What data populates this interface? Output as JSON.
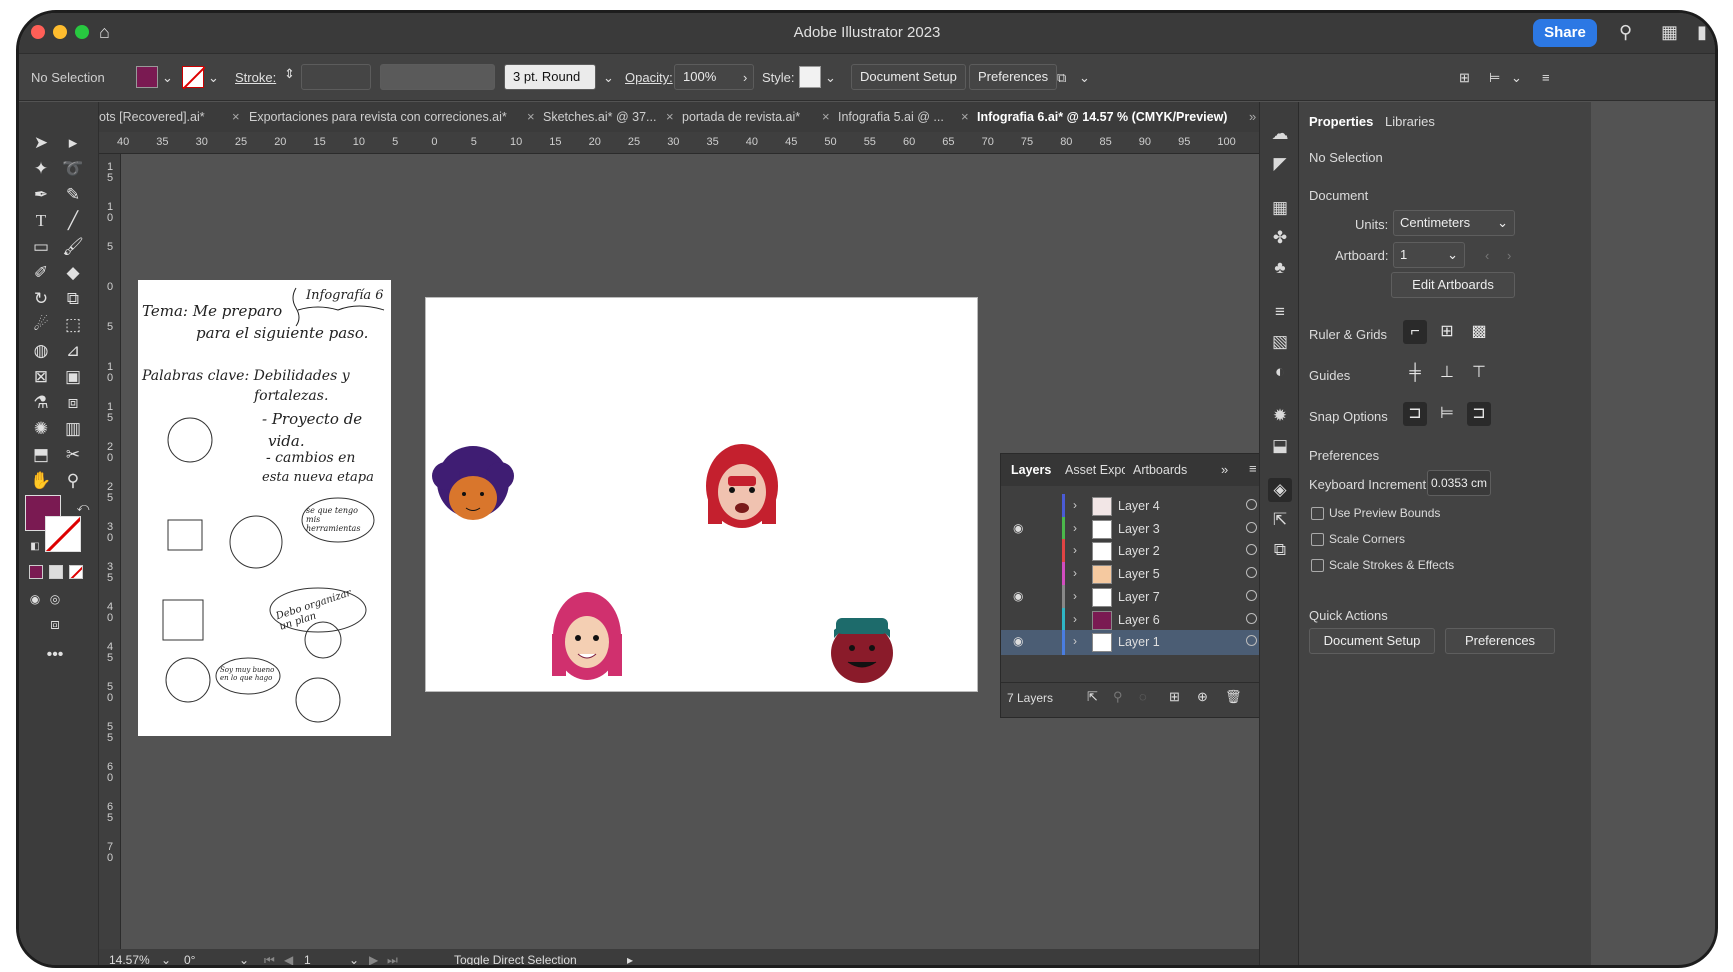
{
  "app": {
    "title": "Adobe Illustrator 2023",
    "share_label": "Share"
  },
  "control_bar": {
    "selection": "No Selection",
    "stroke_label": "Stroke:",
    "brush": "3 pt. Round",
    "opacity_label": "Opacity:",
    "opacity_value": "100%",
    "style_label": "Style:",
    "document_setup": "Document Setup",
    "preferences": "Preferences",
    "fill_color": "#7a1a52",
    "stroke_color": "#7a1a52"
  },
  "tabs": [
    {
      "label": "ots [Recovered].ai*"
    },
    {
      "label": "Exportaciones para revista con correciones.ai*"
    },
    {
      "label": "Sketches.ai* @ 37..."
    },
    {
      "label": "portada de revista.ai*"
    },
    {
      "label": "Infografia 5.ai @ ..."
    },
    {
      "label": "Infografia 6.ai* @ 14.57 % (CMYK/Preview)"
    }
  ],
  "ruler_h": [
    "40",
    "35",
    "30",
    "25",
    "20",
    "15",
    "10",
    "5",
    "0",
    "5",
    "10",
    "15",
    "20",
    "25",
    "30",
    "35",
    "40",
    "45",
    "50",
    "55",
    "60",
    "65",
    "70",
    "75",
    "80",
    "85",
    "90",
    "95",
    "100"
  ],
  "ruler_v": [
    "1 5",
    "1 0",
    "5",
    "0",
    "5",
    "1 0",
    "1 5",
    "2 0",
    "2 5",
    "3 0",
    "3 5",
    "4 0",
    "4 5",
    "5 0",
    "5 5",
    "6 0",
    "6 5",
    "7 0"
  ],
  "sketch": {
    "title": "Infografía 6",
    "line1": "Tema: Me preparo",
    "line2": "para el siguiente paso.",
    "line3": "Palabras clave: Debilidades y",
    "line4": "fortalezas.",
    "bullet1": "- Proyecto de",
    "bullet1b": "vida.",
    "bullet2": "- cambios en",
    "bullet2b": "esta nueva etapa",
    "bubble1": "Debo organizar un plan",
    "bubble2": "Soy muy bueno en lo que hago",
    "bubble3": "se que tengo mis herramientas"
  },
  "layers_panel": {
    "tabs": [
      "Layers",
      "Asset Expo",
      "Artboards"
    ],
    "count": "7 Layers",
    "rows": [
      {
        "name": "Layer 4",
        "color": "#4a5bd6",
        "visible": false,
        "thumb": "#f2e6e6"
      },
      {
        "name": "Layer 3",
        "color": "#4bb84b",
        "visible": true,
        "thumb": "#ffffff"
      },
      {
        "name": "Layer 2",
        "color": "#e04444",
        "visible": false,
        "thumb": "#ffffff"
      },
      {
        "name": "Layer 5",
        "color": "#d24dc0",
        "visible": false,
        "thumb": "#f5c9a0"
      },
      {
        "name": "Layer 7",
        "color": "#888888",
        "visible": true,
        "thumb": "#ffffff"
      },
      {
        "name": "Layer 6",
        "color": "#2fb6c5",
        "visible": false,
        "thumb": "#7a1a52"
      },
      {
        "name": "Layer 1",
        "color": "#4a7de0",
        "visible": true,
        "thumb": "#ffffff",
        "selected": true
      }
    ]
  },
  "properties": {
    "tab_properties": "Properties",
    "tab_libraries": "Libraries",
    "no_selection": "No Selection",
    "document": "Document",
    "units_label": "Units:",
    "units_value": "Centimeters",
    "artboard_label": "Artboard:",
    "artboard_value": "1",
    "edit_artboards": "Edit Artboards",
    "ruler_grids": "Ruler & Grids",
    "guides": "Guides",
    "snap_options": "Snap Options",
    "preferences": "Preferences",
    "keyboard_increment_label": "Keyboard Increment:",
    "keyboard_increment_value": "0.0353 cm",
    "use_preview_bounds": "Use Preview Bounds",
    "scale_corners": "Scale Corners",
    "scale_strokes": "Scale Strokes & Effects",
    "quick_actions": "Quick Actions",
    "qa_document_setup": "Document Setup",
    "qa_preferences": "Preferences"
  },
  "status_bar": {
    "zoom": "14.57%",
    "rotation": "0°",
    "artboard_num": "1",
    "tool_hint": "Toggle Direct Selection"
  }
}
